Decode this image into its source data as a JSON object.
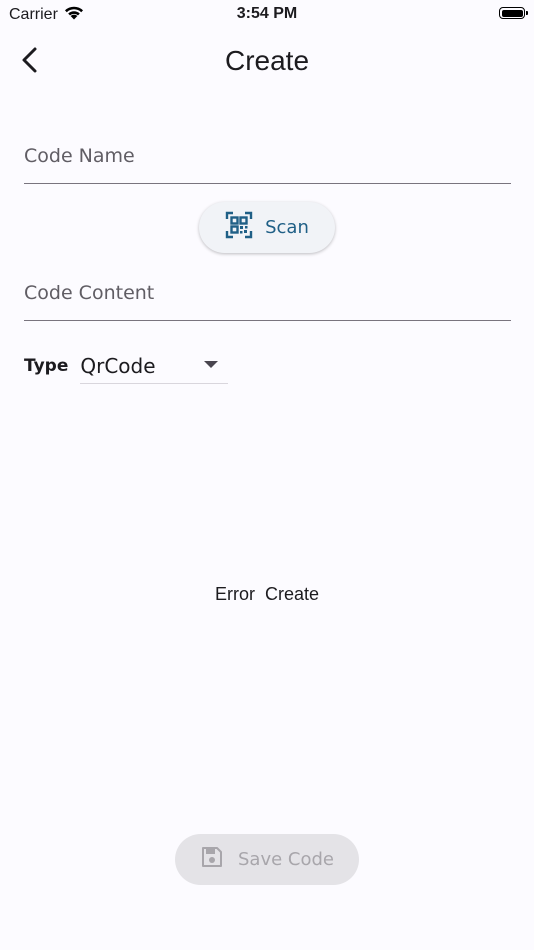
{
  "status_bar": {
    "carrier": "Carrier",
    "time": "3:54 PM"
  },
  "header": {
    "title": "Create"
  },
  "form": {
    "code_name_placeholder": "Code Name",
    "scan_label": "Scan",
    "code_content_placeholder": "Code Content",
    "type_label": "Type",
    "type_selected": "QrCode"
  },
  "error_message": "Error  Create",
  "save_label": "Save Code",
  "colors": {
    "background": "#fcfbff",
    "accent": "#1f5f86",
    "disabled_text": "#a8a6ab"
  },
  "icons": {
    "back": "chevron-left-icon",
    "scan": "qr-scan-icon",
    "save": "save-icon",
    "dropdown": "caret-down-icon"
  }
}
